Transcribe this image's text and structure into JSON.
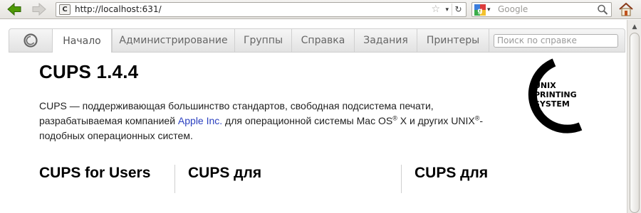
{
  "browser": {
    "url": "http://localhost:631/",
    "site_icon": "C",
    "search_placeholder": "Google",
    "icons": {
      "back": "back-arrow-icon",
      "forward": "forward-arrow-icon",
      "bookmark": "star-icon",
      "history": "dropdown-icon",
      "reload": "reload-icon",
      "engine": "google-icon",
      "search": "magnifier-icon",
      "home": "home-icon"
    },
    "colors": {
      "back_arrow": "#4e9a06",
      "forward_arrow": "#c8c6c2"
    }
  },
  "cups_nav": {
    "tabs": [
      {
        "label": "Начало",
        "active": true
      },
      {
        "label": "Администрирование",
        "active": false
      },
      {
        "label": "Группы",
        "active": false
      },
      {
        "label": "Справка",
        "active": false
      },
      {
        "label": "Задания",
        "active": false
      },
      {
        "label": "Принтеры",
        "active": false
      }
    ],
    "search_placeholder": "Поиск по справке"
  },
  "page": {
    "title": "CUPS 1.4.4",
    "intro": {
      "part1": "CUPS — поддерживающая большинство стандартов, свободная подсистема печати, разрабатываемая компанией ",
      "link": "Apple Inc.",
      "part2": " для операционной системы Mac OS",
      "reg1": "®",
      "part3": " X и других UNIX",
      "reg2": "®",
      "part4": "-подобных операционных систем."
    },
    "logo": {
      "line1": "UNIX",
      "line2": "PRINTING",
      "line3": "SYSTEM"
    },
    "columns": [
      {
        "heading": "CUPS for Users"
      },
      {
        "heading": "CUPS для"
      },
      {
        "heading": "CUPS для"
      }
    ]
  }
}
